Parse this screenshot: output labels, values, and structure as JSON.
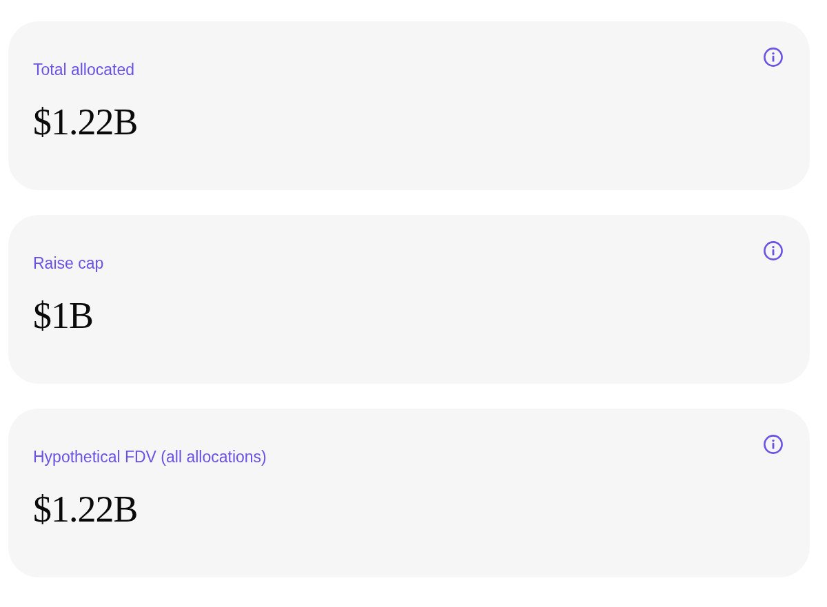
{
  "cards": [
    {
      "label": "Total allocated",
      "value": "$1.22B"
    },
    {
      "label": "Raise cap",
      "value": "$1B"
    },
    {
      "label": "Hypothetical FDV (all allocations)",
      "value": "$1.22B"
    }
  ]
}
